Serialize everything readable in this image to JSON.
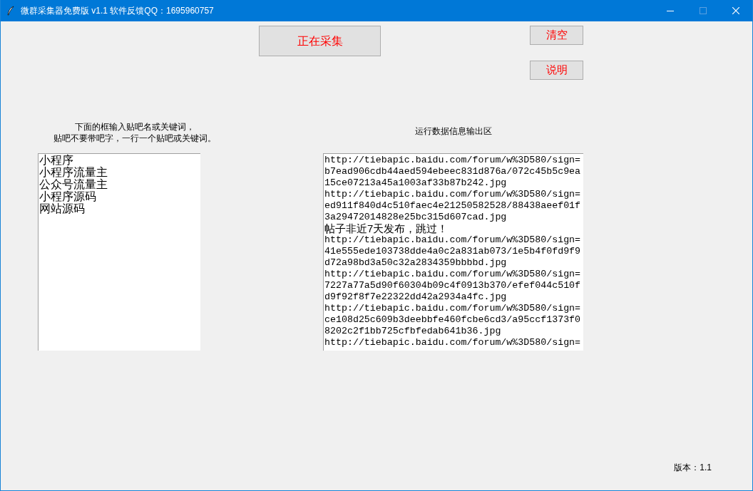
{
  "window": {
    "title": "微群采集器免费版 v1.1 软件反馈QQ：1695960757"
  },
  "buttons": {
    "collect": "正在采集",
    "clear": "清空",
    "help": "说明"
  },
  "keywords": {
    "hint_lines": [
      "下面的框输入贴吧名或关键词，",
      "贴吧不要带吧字，一行一个贴吧或关键词。"
    ],
    "lines": [
      "小程序",
      "小程序流量主",
      "公众号流量主",
      "小程序源码",
      "网站源码"
    ]
  },
  "output": {
    "label": "运行数据信息输出区",
    "lines": [
      {
        "kind": "url",
        "text": "http://tiebapic.baidu.com/forum/w%3D580/sign="
      },
      {
        "kind": "url",
        "text": "b7ead906cdb44aed594ebeec831d876a/072c45b5c9ea"
      },
      {
        "kind": "url",
        "text": "15ce07213a45a1003af33b87b242.jpg"
      },
      {
        "kind": "url",
        "text": "http://tiebapic.baidu.com/forum/w%3D580/sign="
      },
      {
        "kind": "url",
        "text": "ed911f840d4c510faec4e21250582528/88438aeef01f"
      },
      {
        "kind": "url",
        "text": "3a29472014828e25bc315d607cad.jpg"
      },
      {
        "kind": "message",
        "text": "帖子非近7天发布，跳过！"
      },
      {
        "kind": "url",
        "text": "http://tiebapic.baidu.com/forum/w%3D580/sign="
      },
      {
        "kind": "url",
        "text": "41e555ede103738dde4a0c2a831ab073/1e5b4f0fd9f9"
      },
      {
        "kind": "url",
        "text": "d72a98bd3a50c32a2834359bbbbd.jpg"
      },
      {
        "kind": "url",
        "text": "http://tiebapic.baidu.com/forum/w%3D580/sign="
      },
      {
        "kind": "url",
        "text": "7227a77a5d90f60304b09c4f0913b370/efef044c510f"
      },
      {
        "kind": "url",
        "text": "d9f92f8f7e22322dd42a2934a4fc.jpg"
      },
      {
        "kind": "url",
        "text": "http://tiebapic.baidu.com/forum/w%3D580/sign="
      },
      {
        "kind": "url",
        "text": "ce108d25c609b3deebbfe460fcbe6cd3/a95ccf1373f0"
      },
      {
        "kind": "url",
        "text": "8202c2f1bb725cfbfedab641b36.jpg"
      },
      {
        "kind": "url",
        "text": "http://tiebapic.baidu.com/forum/w%3D580/sign="
      }
    ]
  },
  "version": "版本：1.1"
}
